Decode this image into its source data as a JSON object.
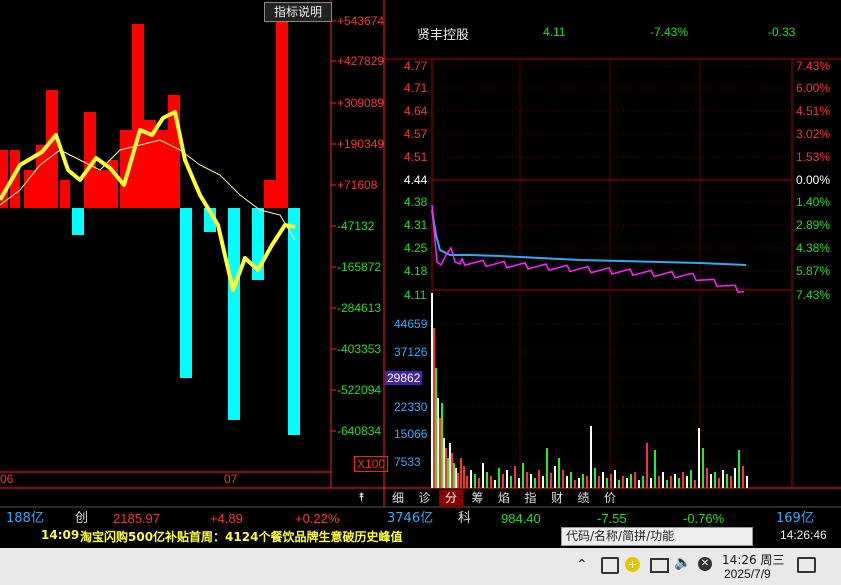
{
  "left_panel": {
    "indicator_button": "指标说明",
    "y_labels": [
      "+543674",
      "+427829",
      "+309089",
      "+190349",
      "+71608",
      "-47132",
      "-165872",
      "-284613",
      "-403353",
      "-522094",
      "-640834"
    ],
    "x_labels": [
      "06",
      "07"
    ],
    "multiplier": "X100",
    "bars": [
      0.17,
      0.06,
      0.13,
      0.07,
      0.12,
      0.06,
      0.09,
      0.03,
      0.17,
      0.09,
      0.11,
      0.05,
      0.05,
      0.07,
      -0.04,
      -0.12,
      -0.31,
      -0.18,
      -0.09,
      -0.75,
      -0.19,
      -0.04,
      -0.39,
      -0.07,
      0.07,
      -0.71,
      0.15,
      0.49,
      -0.78,
      -0.12,
      0.59,
      0.67,
      0.21,
      0.6,
      0.35,
      -0.88,
      -0.21,
      0.48,
      0.54,
      -0.14,
      -0.59,
      0.71,
      0.35,
      0.4,
      0.72,
      0.55,
      0.4,
      0.4,
      0.34,
      0.62,
      0.2,
      0.72
    ],
    "colors": {
      "up": "#ff0000",
      "down": "#00ffff",
      "axis": "#ff2020",
      "line": "#ffff33"
    }
  },
  "right_panel": {
    "stock_name": "贤丰控股",
    "price": "4.11",
    "change_pct": "-7.43%",
    "change": "-0.33",
    "price_labels_left": [
      "4.77",
      "4.71",
      "4.64",
      "4.57",
      "4.51",
      "4.44",
      "4.38",
      "4.31",
      "4.25",
      "4.18",
      "4.11"
    ],
    "price_labels_right": [
      "7.43%",
      "6.00%",
      "4.51%",
      "3.02%",
      "1.53%",
      "0.00%",
      "1.40%",
      "2.89%",
      "4.38%",
      "5.87%",
      "7.43%"
    ],
    "volume_labels": [
      "44659",
      "37126",
      "29862",
      "22330",
      "15066",
      "7533"
    ],
    "volume_highlight": "29862",
    "avg_line_color": "#33aaee",
    "price_line_color": "#ff22ff",
    "tabs": [
      "细",
      "诊",
      "分",
      "筹",
      "焰",
      "指",
      "财",
      "绩",
      "价"
    ],
    "active_tab": "分"
  },
  "index_bar": {
    "left_amount": "188亿",
    "chuang_label": "创",
    "chuang_value": "2185.97",
    "chuang_change": "+4.89",
    "chuang_pct": "+0.22%",
    "mid_amount": "3746亿",
    "ke_label": "科",
    "ke_value": "984.40",
    "ke_change": "-7.55",
    "ke_pct": "-0.76%",
    "ke_amount": "169亿"
  },
  "news": {
    "time": "14:09",
    "headline": "淘宝闪购500亿补贴首周：4124个餐饮品牌生意破历史峰值",
    "search_placeholder": "代码/名称/简拼/功能",
    "clock": "14:26:46"
  },
  "taskbar": {
    "time": "14:26 周三",
    "date": "2025/7/9"
  }
}
